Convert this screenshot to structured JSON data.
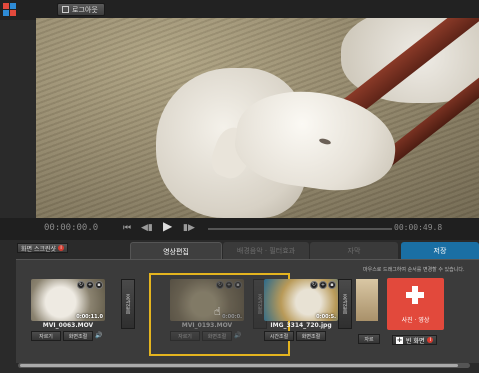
{
  "topbar": {
    "logout_label": "로그아웃"
  },
  "player": {
    "current_time": "00:00:00.0",
    "total_time": "00:00:49.8",
    "progress": 0.0
  },
  "record_label": "화면 스크린샷",
  "tabs": [
    {
      "label": "영상편집",
      "active": true
    },
    {
      "label": "배경음악 · 필터효과",
      "active": false
    },
    {
      "label": "자막",
      "active": false
    },
    {
      "label": "저장",
      "active": false
    }
  ],
  "hint": "마우스로 드래그하여 순서를 변경할 수 있습니다.",
  "clips": [
    {
      "name": "MVI_0063.MOV",
      "duration": "0:00:11.0",
      "btn_cut": "자르기",
      "btn_screen": "화면조절"
    },
    {
      "name": "MVI_0193.MOV",
      "duration": "0:00:0.",
      "btn_cut": "자르기",
      "btn_screen": "화면조절"
    },
    {
      "name": "IMG_3314_720.jpg",
      "duration": "0:00:5.",
      "btn_time": "시간조절",
      "btn_screen": "화면조절"
    },
    {
      "btn_cut": "자르"
    }
  ],
  "effect_label": "효과없음",
  "add_card": {
    "label": "사진 · 영상"
  },
  "blank_button": {
    "label": "빈 화면"
  },
  "colors": {
    "save_tab": "#1a6fa4",
    "add_card": "#e2493c",
    "selection": "#e4b41f"
  }
}
